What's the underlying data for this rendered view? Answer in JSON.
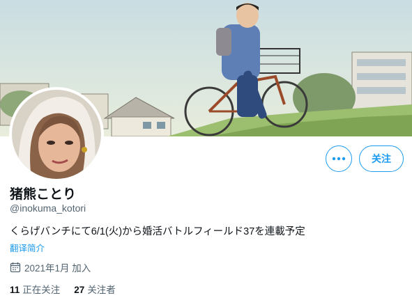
{
  "profile": {
    "display_name": "猪熊ことり",
    "handle": "@inokuma_kotori",
    "bio": "くらげバンチにて6/1(火)から婚活バトルフィールド37を連載予定",
    "translate_label": "翻译简介",
    "joined": "2021年1月 加入",
    "following_count": "11",
    "following_label": "正在关注",
    "followers_count": "27",
    "followers_label": "关注者"
  },
  "actions": {
    "follow_label": "关注"
  },
  "icons": {
    "more": "more-horizontal-icon",
    "calendar": "calendar-icon"
  },
  "colors": {
    "accent": "#1d9bf0",
    "secondary_text": "#536471",
    "primary_text": "#0f1419"
  }
}
